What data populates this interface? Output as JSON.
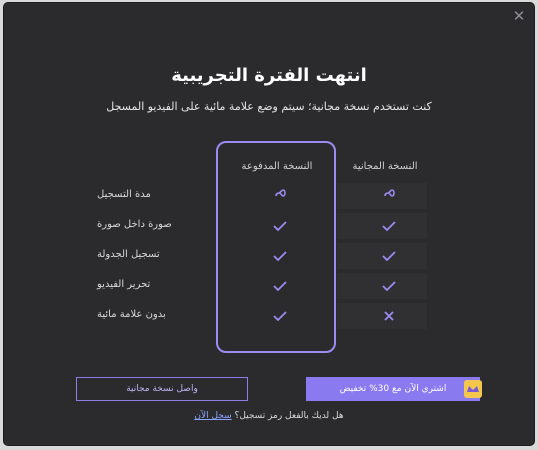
{
  "dialog": {
    "close_label": "✕",
    "title": "انتهت الفترة التجريبية",
    "subtitle": "كنت تستخدم نسخة مجانية؛ سيتم وضع علامة مائية على الفيديو المسجل"
  },
  "columns": {
    "paid": "النسخة المدفوعة",
    "free": "النسخة المجانية"
  },
  "features": [
    {
      "label": "مدة التسجيل",
      "paid": "infinity",
      "free": "infinity"
    },
    {
      "label": "صورة داخل صورة",
      "paid": "check",
      "free": "check"
    },
    {
      "label": "تسجيل الجدولة",
      "paid": "check",
      "free": "check"
    },
    {
      "label": "تحرير الفيديو",
      "paid": "check",
      "free": "check"
    },
    {
      "label": "بدون علامة مائية",
      "paid": "check",
      "free": "cross"
    }
  ],
  "buttons": {
    "continue_free": "واصل نسخة مجانية",
    "buy_now": "اشتري الآن مع 30% تخفيض"
  },
  "footer": {
    "question": "هل لديك بالفعل رمز تسجيل؟",
    "link": "سجل الآن"
  },
  "colors": {
    "accent": "#8a7af0",
    "frame": "#9a8cf0",
    "background": "#2b2b2e"
  }
}
